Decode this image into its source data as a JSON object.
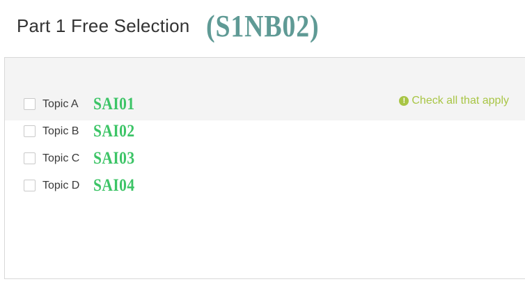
{
  "header": {
    "title": "Part 1 Free Selection",
    "code": "(S1NB02)"
  },
  "panel": {
    "hint_text": "Check all that apply",
    "hint_icon": "exclamation-circle-icon",
    "accent_color": "#a8c545"
  },
  "options": [
    {
      "label": "Topic A",
      "code": "SAI01",
      "checked": false
    },
    {
      "label": "Topic B",
      "code": "SAI02",
      "checked": false
    },
    {
      "label": "Topic C",
      "code": "SAI03",
      "checked": false
    },
    {
      "label": "Topic D",
      "code": "SAI04",
      "checked": false
    }
  ],
  "colors": {
    "title_code": "#5f9a95",
    "option_code": "#3cc466"
  }
}
